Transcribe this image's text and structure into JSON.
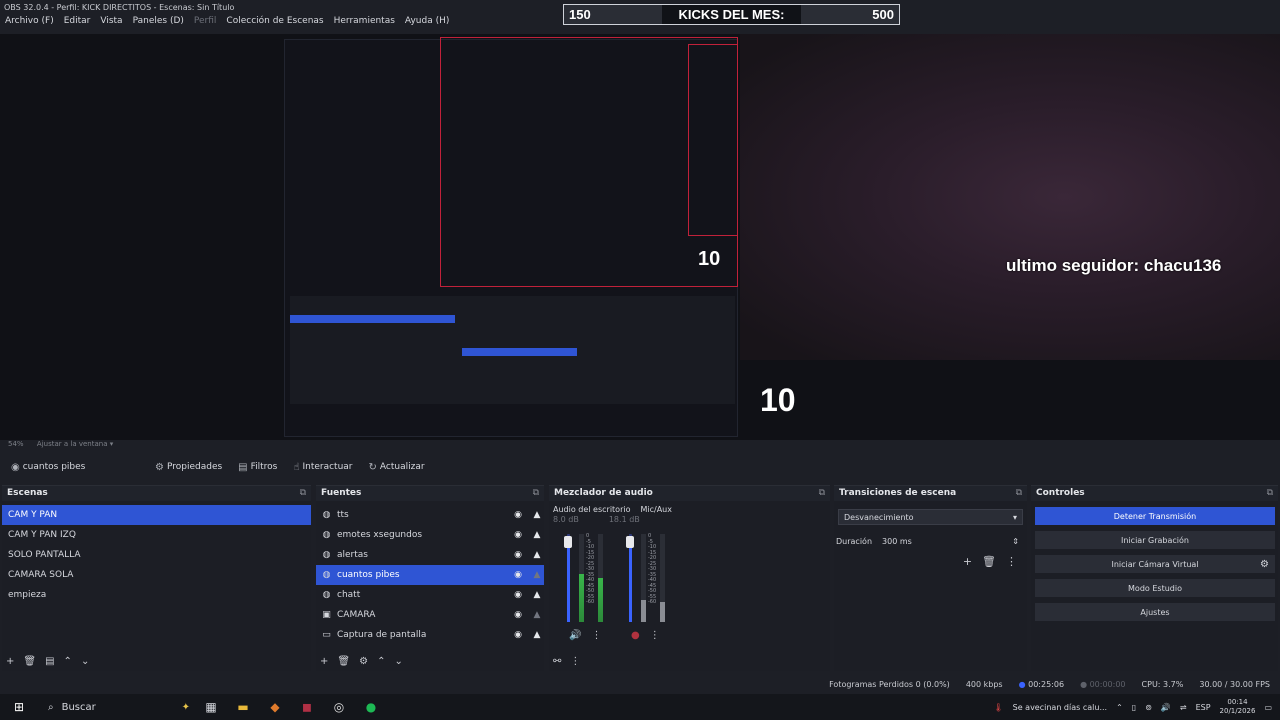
{
  "window": {
    "title": "OBS 32.0.4 - Perfil: KICK DIRECTITOS - Escenas: Sin Título"
  },
  "menu": [
    "Archivo (F)",
    "Editar",
    "Vista",
    "Paneles (D)",
    "Perfil",
    "Colección de Escenas",
    "Herramientas",
    "Ayuda (H)"
  ],
  "overlay": {
    "kick_left": "150",
    "kick_title": "KICKS DEL MES:",
    "kick_right": "500",
    "follower": "ultimo seguidor: chacu136",
    "counter_big": "10",
    "counter_small": "10"
  },
  "zoom": {
    "label": "54%",
    "fit": "Ajustar a la ventana"
  },
  "toolbar": {
    "current_source": "cuantos pibes",
    "properties": "Propiedades",
    "filters": "Filtros",
    "interact": "Interactuar",
    "refresh": "Actualizar"
  },
  "scenes": {
    "title": "Escenas",
    "items": [
      "CAM Y PAN",
      "CAM Y PAN IZQ",
      "SOLO PANTALLA",
      "CAMARA SOLA",
      "empieza"
    ],
    "selected_index": 0
  },
  "sources": {
    "title": "Fuentes",
    "items": [
      {
        "label": "tts",
        "icon": "browser-icon"
      },
      {
        "label": "emotes xsegundos",
        "icon": "browser-icon"
      },
      {
        "label": "alertas",
        "icon": "browser-icon"
      },
      {
        "label": "cuantos pibes",
        "icon": "browser-icon"
      },
      {
        "label": "chatt",
        "icon": "browser-icon"
      },
      {
        "label": "CAMARA",
        "icon": "camera-icon"
      },
      {
        "label": "Captura de pantalla",
        "icon": "monitor-icon"
      }
    ],
    "selected_index": 3
  },
  "mixer": {
    "title": "Mezclador de audio",
    "desktop_label": "Audio del escritorio",
    "desktop_db": "8.0 dB",
    "desktop_level": 0.55,
    "mic_label": "Mic/Aux",
    "mic_db": "18.1 dB",
    "mic_level": 0.25
  },
  "transitions": {
    "title": "Transiciones de escena",
    "selected": "Desvanecimiento",
    "duration_label": "Duración",
    "duration_value": "300 ms"
  },
  "controls": {
    "title": "Controles",
    "stop_stream": "Detener Transmisión",
    "start_recording": "Iniciar Grabación",
    "virtual_cam": "Iniciar Cámara Virtual",
    "studio_mode": "Modo Estudio",
    "settings": "Ajustes"
  },
  "status": {
    "dropped": "Fotogramas Perdidos 0 (0.0%)",
    "bitrate": "400 kbps",
    "stream_time": "00:25:06",
    "rec_time": "00:00:00",
    "cpu": "CPU: 3.7%",
    "fps": "30.00 / 30.00 FPS"
  },
  "taskbar": {
    "search_placeholder": "Buscar",
    "news": "Se avecinan días calu...",
    "lang": "ESP",
    "time": "00:14",
    "date": "20/1/2026"
  },
  "colors": {
    "accent": "#2f55d4",
    "background": "#1d1f26"
  }
}
